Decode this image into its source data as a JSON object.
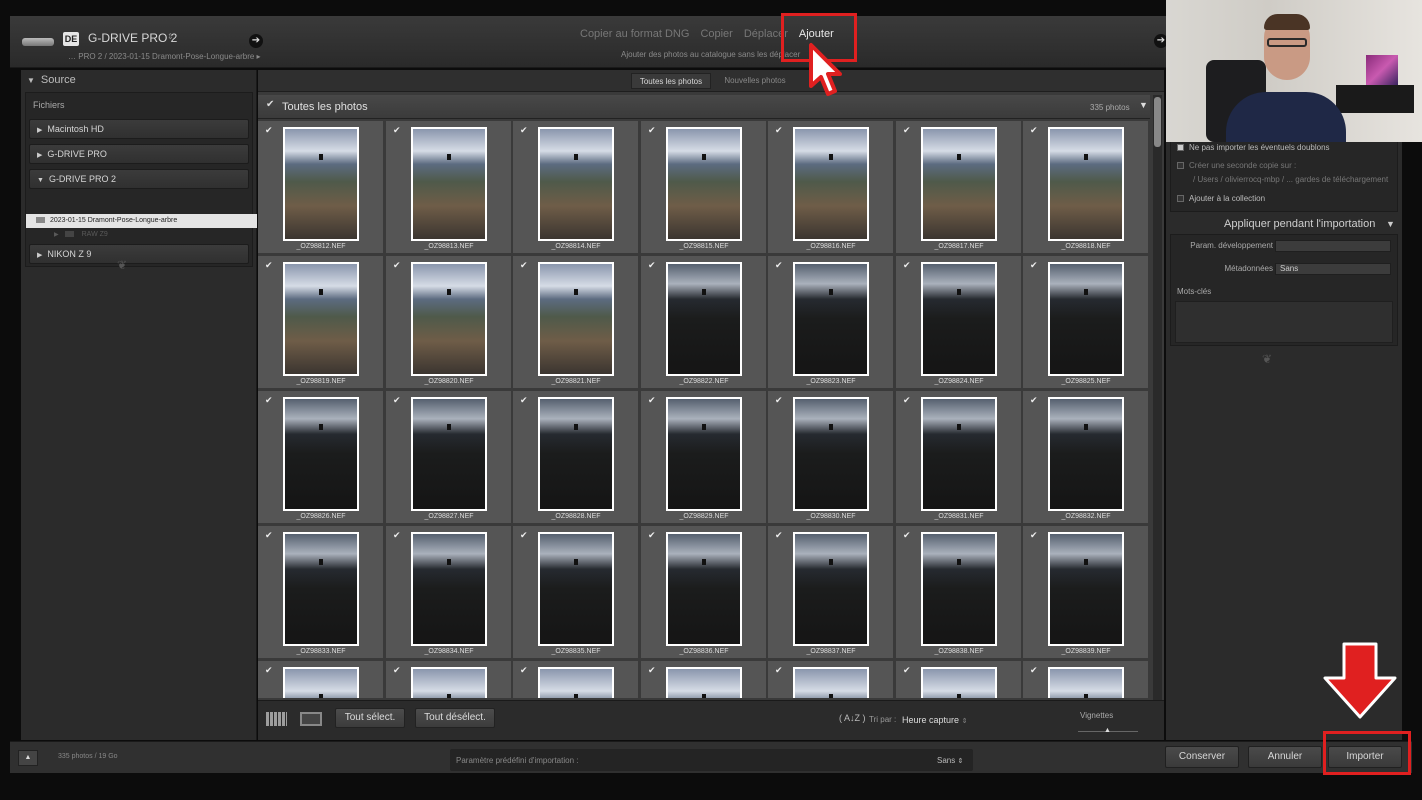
{
  "source": {
    "badge": "DE",
    "name": "G-DRIVE PRO 2",
    "path": "PRO 2 / 2023-01-15 Dramont-Pose-Longue-arbre"
  },
  "mode_tabs": [
    "Copier au format DNG",
    "Copier",
    "Déplacer",
    "Ajouter"
  ],
  "mode_active": "Ajouter",
  "mode_description": "Ajouter des photos au catalogue sans les déplacer",
  "left_panel": {
    "source_title": "Source",
    "files_label": "Fichiers",
    "volumes": [
      "Macintosh HD",
      "G-DRIVE PRO",
      "G-DRIVE PRO 2",
      "NIKON Z 9"
    ],
    "selected_folder": "2023-01-15 Dramont-Pose-Longue-arbre",
    "sub_folder": "RAW Z9"
  },
  "filter_tabs": [
    "Toutes les photos",
    "Nouvelles photos"
  ],
  "grid_header": {
    "title": "Toutes les photos",
    "count": "335 photos"
  },
  "photos": [
    {
      "name": "_OZ98812.NEF",
      "tone": "light"
    },
    {
      "name": "_OZ98813.NEF",
      "tone": "light"
    },
    {
      "name": "_OZ98814.NEF",
      "tone": "light"
    },
    {
      "name": "_OZ98815.NEF",
      "tone": "light"
    },
    {
      "name": "_OZ98816.NEF",
      "tone": "light"
    },
    {
      "name": "_OZ98817.NEF",
      "tone": "light"
    },
    {
      "name": "_OZ98818.NEF",
      "tone": "light"
    },
    {
      "name": "_OZ98819.NEF",
      "tone": "light"
    },
    {
      "name": "_OZ98820.NEF",
      "tone": "light"
    },
    {
      "name": "_OZ98821.NEF",
      "tone": "light"
    },
    {
      "name": "_OZ98822.NEF",
      "tone": "dark"
    },
    {
      "name": "_OZ98823.NEF",
      "tone": "dark"
    },
    {
      "name": "_OZ98824.NEF",
      "tone": "dark"
    },
    {
      "name": "_OZ98825.NEF",
      "tone": "dark"
    },
    {
      "name": "_OZ98826.NEF",
      "tone": "dark"
    },
    {
      "name": "_OZ98827.NEF",
      "tone": "dark"
    },
    {
      "name": "_OZ98828.NEF",
      "tone": "dark"
    },
    {
      "name": "_OZ98829.NEF",
      "tone": "dark"
    },
    {
      "name": "_OZ98830.NEF",
      "tone": "dark"
    },
    {
      "name": "_OZ98831.NEF",
      "tone": "dark"
    },
    {
      "name": "_OZ98832.NEF",
      "tone": "dark"
    },
    {
      "name": "_OZ98833.NEF",
      "tone": "dark"
    },
    {
      "name": "_OZ98834.NEF",
      "tone": "dark"
    },
    {
      "name": "_OZ98835.NEF",
      "tone": "dark"
    },
    {
      "name": "_OZ98836.NEF",
      "tone": "dark"
    },
    {
      "name": "_OZ98837.NEF",
      "tone": "dark"
    },
    {
      "name": "_OZ98838.NEF",
      "tone": "dark"
    },
    {
      "name": "_OZ98839.NEF",
      "tone": "dark"
    },
    {
      "name": "",
      "tone": "light"
    },
    {
      "name": "",
      "tone": "light"
    },
    {
      "name": "",
      "tone": "light"
    },
    {
      "name": "",
      "tone": "light"
    },
    {
      "name": "",
      "tone": "light"
    },
    {
      "name": "",
      "tone": "light"
    },
    {
      "name": "",
      "tone": "light"
    }
  ],
  "toolbar": {
    "select_all": "Tout sélect.",
    "deselect_all": "Tout désélect.",
    "sort_label": "Tri par :",
    "sort_value": "Heure capture",
    "thumbnails_label": "Vignettes"
  },
  "right_panel": {
    "opt_no_duplicates": "Ne pas importer les éventuels doublons",
    "opt_second_copy": "Créer une seconde copie sur :",
    "second_copy_path": "/ Users / olivierrocq-mbp / ... gardes de téléchargement",
    "opt_add_collection": "Ajouter à la collection",
    "apply_title": "Appliquer pendant l'importation",
    "develop_label": "Param. développement",
    "develop_value": "",
    "metadata_label": "Métadonnées",
    "metadata_value": "Sans",
    "keywords_label": "Mots-clés"
  },
  "bottom": {
    "photo_info": "335 photos / 19 Go",
    "preset_label": "Paramètre prédéfini d'importation :",
    "preset_value": "Sans",
    "keep": "Conserver",
    "cancel": "Annuler",
    "import": "Importer"
  },
  "colors": {
    "highlight": "#e02020",
    "panel": "#2b2b2b",
    "grid_cell": "#555555"
  }
}
